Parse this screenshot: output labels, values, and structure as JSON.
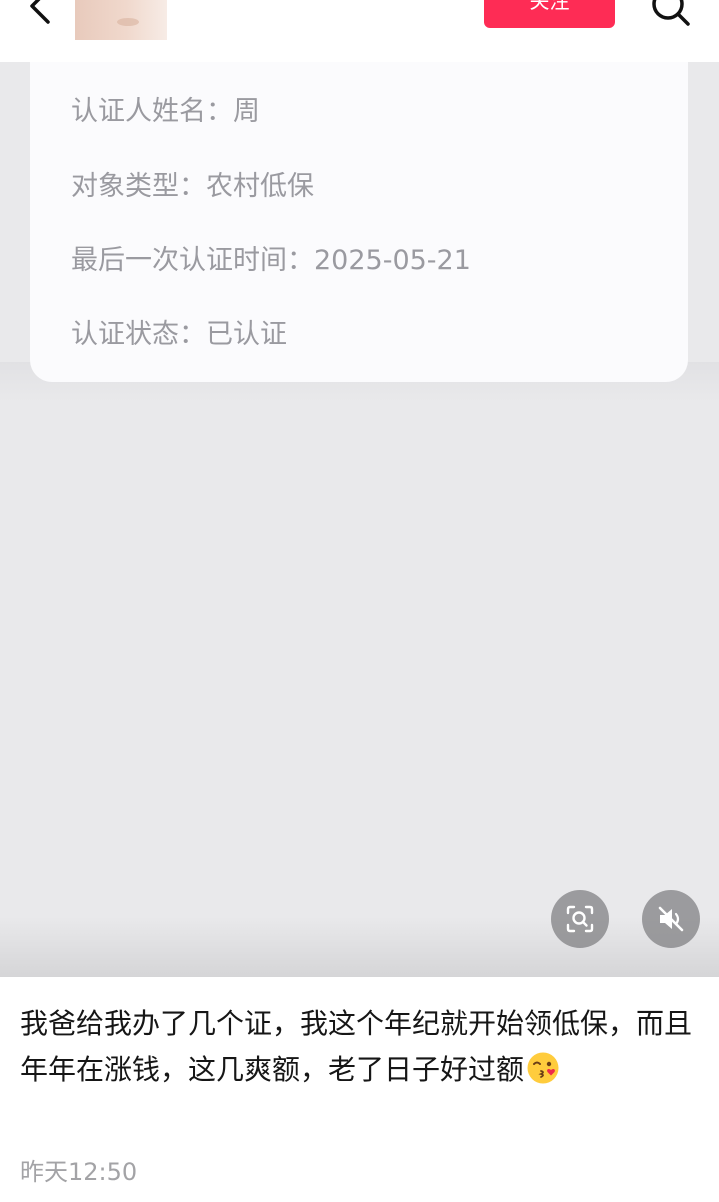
{
  "header": {
    "follow_label": "关注",
    "back_icon": "back-arrow-icon",
    "search_icon": "search-icon",
    "accent_color": "#fe2c55"
  },
  "card": {
    "rows": [
      {
        "label": "认证人姓名：",
        "value": "周"
      },
      {
        "label": "对象类型：",
        "value": "农村低保"
      },
      {
        "label": "最后一次认证时间：",
        "value": "2025-05-21"
      },
      {
        "label": "认证状态：",
        "value": "已认证"
      }
    ]
  },
  "media_controls": {
    "scan_icon": "image-search-icon",
    "mute_icon": "mute-icon"
  },
  "post": {
    "text": "我爸给我办了几个证，我这个年纪就开始领低保，而且年年在涨钱，这几爽额，老了日子好过额",
    "emoji": "kissing-wink-emoji-icon",
    "timestamp": "昨天12:50"
  }
}
